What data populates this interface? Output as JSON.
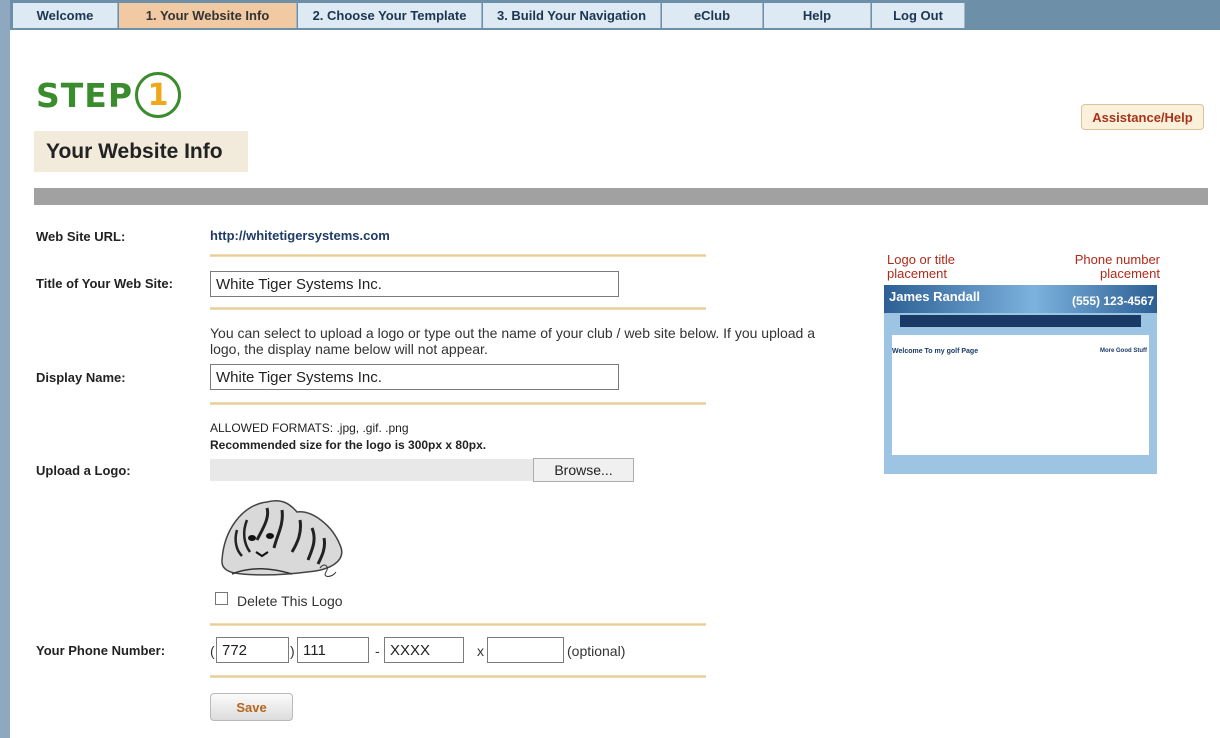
{
  "nav": {
    "tabs": [
      {
        "label": "Welcome",
        "active": false
      },
      {
        "label": "1. Your Website Info",
        "active": true
      },
      {
        "label": "2. Choose Your Template",
        "active": false
      },
      {
        "label": "3. Build Your Navigation",
        "active": false
      },
      {
        "label": "eClub",
        "active": false
      },
      {
        "label": "Help",
        "active": false
      },
      {
        "label": "Log Out",
        "active": false
      }
    ]
  },
  "header": {
    "step_word": "STEP",
    "step_number": "1",
    "page_title": "Your Website Info",
    "assistance_label": "Assistance/Help"
  },
  "form": {
    "url_label": "Web Site URL:",
    "url_value": "http://whitetigersystems.com",
    "title_label": "Title of Your Web Site:",
    "title_value": "White Tiger Systems Inc.",
    "display_note": "You can select to upload a logo or type out the name of your club / web site below. If you upload a logo, the display name below will not appear.",
    "display_label": "Display Name:",
    "display_value": "White Tiger Systems Inc.",
    "formats_line": "ALLOWED FORMATS: .jpg, .gif. .png",
    "size_line": "Recommended size for the logo is 300px x 80px.",
    "upload_label": "Upload a Logo:",
    "browse_label": "Browse...",
    "delete_logo_label": "Delete This Logo",
    "delete_logo_checked": false,
    "phone_label": "Your Phone Number:",
    "phone_area": "772",
    "phone_prefix": "111",
    "phone_line": "XXXX",
    "phone_ext": "",
    "paren_open": "(",
    "paren_close": ")",
    "dash": "-",
    "ext_marker": "x",
    "optional_label": "(optional)",
    "save_label": "Save"
  },
  "preview": {
    "logo_caption": "Logo or title\nplacement",
    "phone_caption": "Phone number\nplacement",
    "sample_name": "James Randall",
    "sample_phone": "(555) 123-4567",
    "sample_heading": "Welcome To my golf Page",
    "sample_side_heading": "More Good Stuff"
  },
  "colors": {
    "nav_bg": "#6d8fa8",
    "tab_bg": "#dde9f3",
    "tab_active_bg": "#f1c9a3",
    "step_green": "#3a8c2c",
    "step_orange": "#f0a81a",
    "accent_red": "#b02a1a"
  }
}
